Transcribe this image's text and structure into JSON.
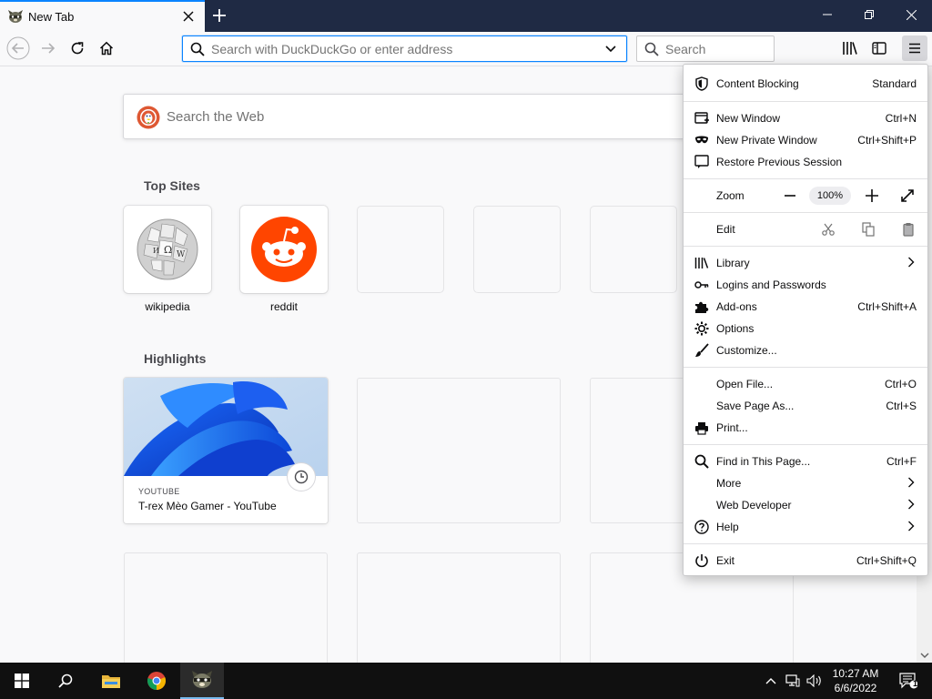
{
  "tab": {
    "title": "New Tab",
    "close_icon": "close-icon",
    "favicon": "raccoon-favicon"
  },
  "window_controls": {
    "minimize": "minimize-icon",
    "restore": "restore-icon",
    "close": "close-icon"
  },
  "navbar": {
    "urlbar_placeholder": "Search with DuckDuckGo or enter address",
    "search_placeholder": "Search"
  },
  "newtab": {
    "websearch_placeholder": "Search the Web",
    "top_sites_title": "Top Sites",
    "top_sites": [
      {
        "label": "wikipedia",
        "icon": "wikipedia-globe"
      },
      {
        "label": "reddit",
        "icon": "reddit-logo"
      },
      {
        "label": ""
      },
      {
        "label": ""
      },
      {
        "label": ""
      }
    ],
    "highlights_title": "Highlights",
    "highlight": {
      "source": "YOUTUBE",
      "title": "T-rex Mèo Gamer - YouTube"
    }
  },
  "appmenu": {
    "content_blocking": {
      "label": "Content Blocking",
      "value": "Standard"
    },
    "new_window": {
      "label": "New Window",
      "shortcut": "Ctrl+N"
    },
    "new_private_window": {
      "label": "New Private Window",
      "shortcut": "Ctrl+Shift+P"
    },
    "restore_session": {
      "label": "Restore Previous Session"
    },
    "zoom": {
      "label": "Zoom",
      "value": "100%"
    },
    "edit": {
      "label": "Edit"
    },
    "library": {
      "label": "Library"
    },
    "logins": {
      "label": "Logins and Passwords"
    },
    "addons": {
      "label": "Add-ons",
      "shortcut": "Ctrl+Shift+A"
    },
    "options": {
      "label": "Options"
    },
    "customize": {
      "label": "Customize..."
    },
    "open_file": {
      "label": "Open File...",
      "shortcut": "Ctrl+O"
    },
    "save_page": {
      "label": "Save Page As...",
      "shortcut": "Ctrl+S"
    },
    "print": {
      "label": "Print..."
    },
    "find": {
      "label": "Find in This Page...",
      "shortcut": "Ctrl+F"
    },
    "more": {
      "label": "More"
    },
    "web_developer": {
      "label": "Web Developer"
    },
    "help": {
      "label": "Help"
    },
    "exit": {
      "label": "Exit",
      "shortcut": "Ctrl+Shift+Q"
    }
  },
  "taskbar": {
    "time": "10:27 AM",
    "date": "6/6/2022",
    "notification_count": "1"
  },
  "colors": {
    "accent": "#0a84ff",
    "tabbar": "#1f2a44",
    "reddit": "#ff4500",
    "taskbar": "#101010"
  }
}
